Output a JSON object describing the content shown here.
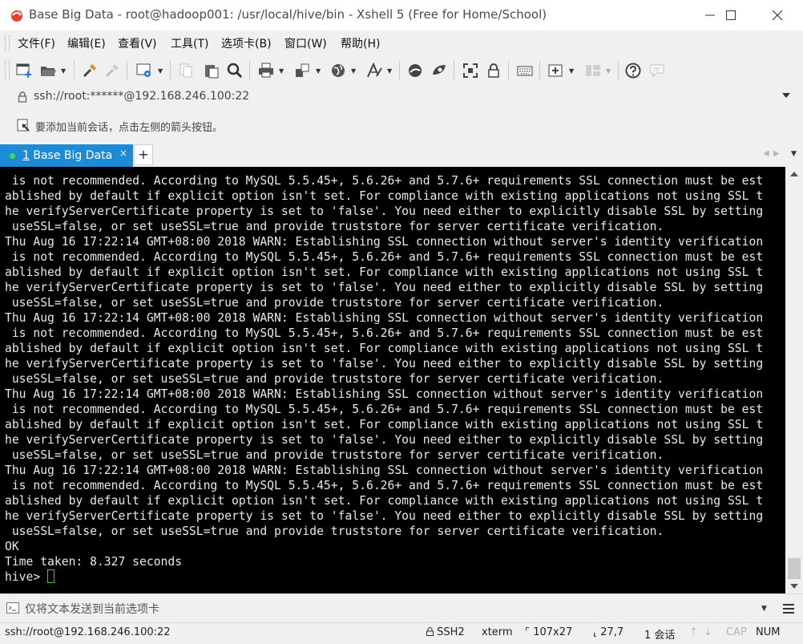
{
  "window": {
    "title": "Base Big Data - root@hadoop001: /usr/local/hive/bin - Xshell 5 (Free for Home/School)"
  },
  "menu": {
    "items": [
      "文件(F)",
      "编辑(E)",
      "查看(V)",
      "工具(T)",
      "选项卡(B)",
      "窗口(W)",
      "帮助(H)"
    ]
  },
  "toolbar": {
    "icons": [
      "new-session-icon",
      "open-folder-icon",
      "reconnect-icon",
      "disconnect-icon",
      "properties-icon",
      "copy-icon",
      "paste-icon",
      "find-icon",
      "print-icon",
      "transfer-icon",
      "globe-icon",
      "font-icon",
      "xftp-icon",
      "xmanager-icon",
      "fullscreen-icon",
      "lock-icon",
      "keyboard-icon",
      "add-tab-icon",
      "layout-icon",
      "help-icon",
      "chat-icon"
    ]
  },
  "address": {
    "value": "ssh://root:******@192.168.246.100:22"
  },
  "hint": {
    "text": "要添加当前会话，点击左侧的箭头按钮。"
  },
  "tabs": [
    {
      "number": "1",
      "label": "Base Big Data",
      "close": "×"
    }
  ],
  "terminal": {
    "lines": [
      " is not recommended. According to MySQL 5.5.45+, 5.6.26+ and 5.7.6+ requirements SSL connection must be est",
      "ablished by default if explicit option isn't set. For compliance with existing applications not using SSL t",
      "he verifyServerCertificate property is set to 'false'. You need either to explicitly disable SSL by setting",
      " useSSL=false, or set useSSL=true and provide truststore for server certificate verification.",
      "Thu Aug 16 17:22:14 GMT+08:00 2018 WARN: Establishing SSL connection without server's identity verification",
      " is not recommended. According to MySQL 5.5.45+, 5.6.26+ and 5.7.6+ requirements SSL connection must be est",
      "ablished by default if explicit option isn't set. For compliance with existing applications not using SSL t",
      "he verifyServerCertificate property is set to 'false'. You need either to explicitly disable SSL by setting",
      " useSSL=false, or set useSSL=true and provide truststore for server certificate verification.",
      "Thu Aug 16 17:22:14 GMT+08:00 2018 WARN: Establishing SSL connection without server's identity verification",
      " is not recommended. According to MySQL 5.5.45+, 5.6.26+ and 5.7.6+ requirements SSL connection must be est",
      "ablished by default if explicit option isn't set. For compliance with existing applications not using SSL t",
      "he verifyServerCertificate property is set to 'false'. You need either to explicitly disable SSL by setting",
      " useSSL=false, or set useSSL=true and provide truststore for server certificate verification.",
      "Thu Aug 16 17:22:14 GMT+08:00 2018 WARN: Establishing SSL connection without server's identity verification",
      " is not recommended. According to MySQL 5.5.45+, 5.6.26+ and 5.7.6+ requirements SSL connection must be est",
      "ablished by default if explicit option isn't set. For compliance with existing applications not using SSL t",
      "he verifyServerCertificate property is set to 'false'. You need either to explicitly disable SSL by setting",
      " useSSL=false, or set useSSL=true and provide truststore for server certificate verification.",
      "Thu Aug 16 17:22:14 GMT+08:00 2018 WARN: Establishing SSL connection without server's identity verification",
      " is not recommended. According to MySQL 5.5.45+, 5.6.26+ and 5.7.6+ requirements SSL connection must be est",
      "ablished by default if explicit option isn't set. For compliance with existing applications not using SSL t",
      "he verifyServerCertificate property is set to 'false'. You need either to explicitly disable SSL by setting",
      " useSSL=false, or set useSSL=true and provide truststore for server certificate verification.",
      "OK",
      "Time taken: 8.327 seconds"
    ],
    "prompt": "hive> "
  },
  "compose": {
    "placeholder": "仅将文本发送到当前选项卡"
  },
  "status": {
    "connection": "ssh://root@192.168.246.100:22",
    "protocol": "SSH2",
    "terminal_type": "xterm",
    "size": "107x27",
    "cursor_pos": "27,7",
    "sessions": "1 会话",
    "caps": "CAP",
    "num": "NUM"
  },
  "colors": {
    "tab_active": "#1e8bd6",
    "terminal_bg": "#000000",
    "terminal_fg": "#e8e8e8",
    "cursor": "#22dd22",
    "app_icon": "#e2452f"
  }
}
